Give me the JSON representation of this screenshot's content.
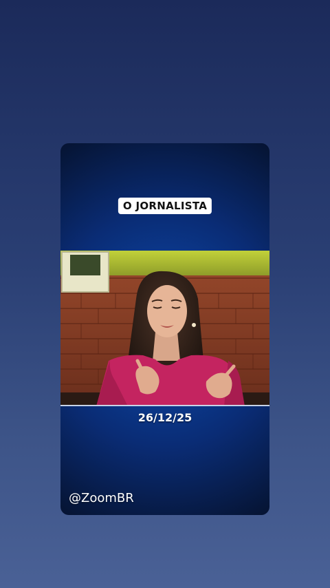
{
  "post": {
    "title": "O JORNALISTA",
    "date": "26/12/25",
    "handle": "@ZoomBR"
  },
  "colors": {
    "background_top": "#1b2a5a",
    "background_bottom": "#4a6196",
    "card_glow": "#0d4cb0",
    "badge_bg": "#ffffff"
  }
}
